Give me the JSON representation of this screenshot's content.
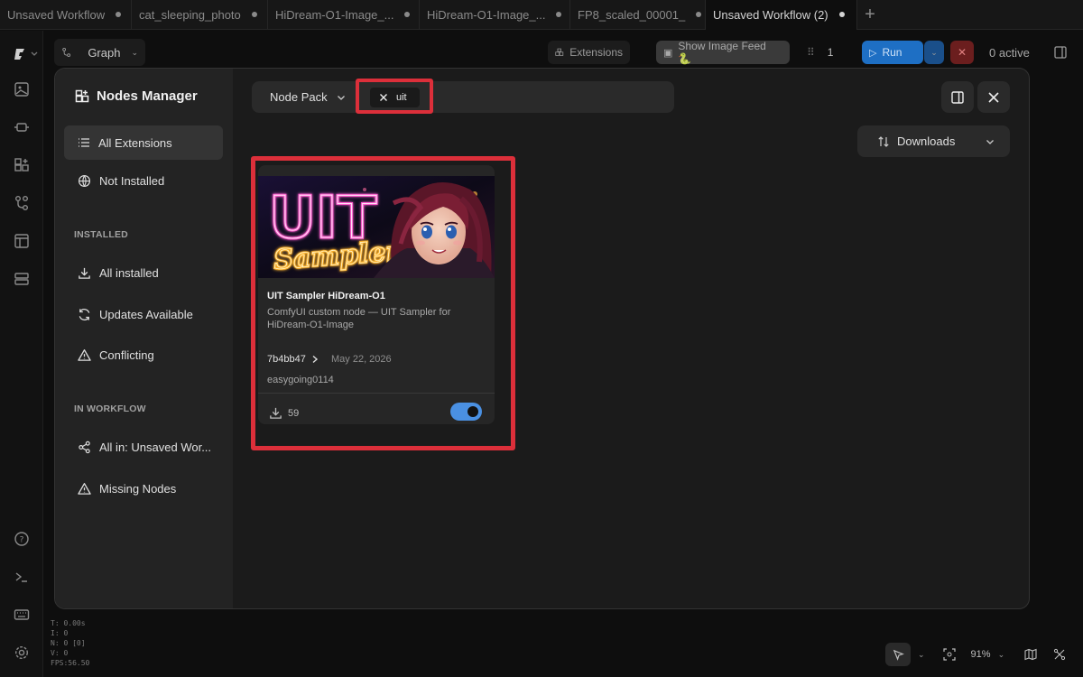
{
  "tabs": [
    {
      "label": "Unsaved Workflow",
      "active": false
    },
    {
      "label": "cat_sleeping_photo",
      "active": false
    },
    {
      "label": "HiDream-O1-Image_...",
      "active": false
    },
    {
      "label": "HiDream-O1-Image_...",
      "active": false
    },
    {
      "label": "FP8_scaled_00001_",
      "active": false
    },
    {
      "label": "Unsaved Workflow (2)",
      "active": true
    }
  ],
  "toolbar": {
    "graph_label": "Graph",
    "extensions_label": "Extensions",
    "show_feed_label": "Show Image Feed 🐍",
    "batch_count": "1",
    "run_label": "Run",
    "active_label": "0 active"
  },
  "dialog": {
    "title": "Nodes Manager",
    "nav": {
      "all_extensions": "All Extensions",
      "not_installed": "Not Installed",
      "installed_header": "INSTALLED",
      "all_installed": "All installed",
      "updates_available": "Updates Available",
      "conflicting": "Conflicting",
      "workflow_header": "IN WORKFLOW",
      "all_in_workflow": "All in: Unsaved Wor...",
      "missing_nodes": "Missing Nodes"
    },
    "search": {
      "filter_label": "Node Pack",
      "chip_text": "uit"
    },
    "sort_label": "Downloads",
    "card": {
      "title": "UIT Sampler HiDream-O1",
      "description": "ComfyUI custom node — UIT Sampler for HiDream-O1-Image",
      "version": "7b4bb47",
      "date": "May 22, 2026",
      "author": "easygoing0114",
      "downloads": "59",
      "enabled": true,
      "image_text_top": "UIT",
      "image_text_bottom": "Sampler"
    }
  },
  "debug": {
    "lines": [
      "T: 0.00s",
      "I: 0",
      "N: 0 [0]",
      "V: 0",
      "FPS:56.50"
    ]
  },
  "canvas": {
    "zoom": "91%"
  },
  "colors": {
    "highlight": "#dc2f3a",
    "accent_blue": "#4a90e2",
    "run_button": "#1e6fc4"
  }
}
